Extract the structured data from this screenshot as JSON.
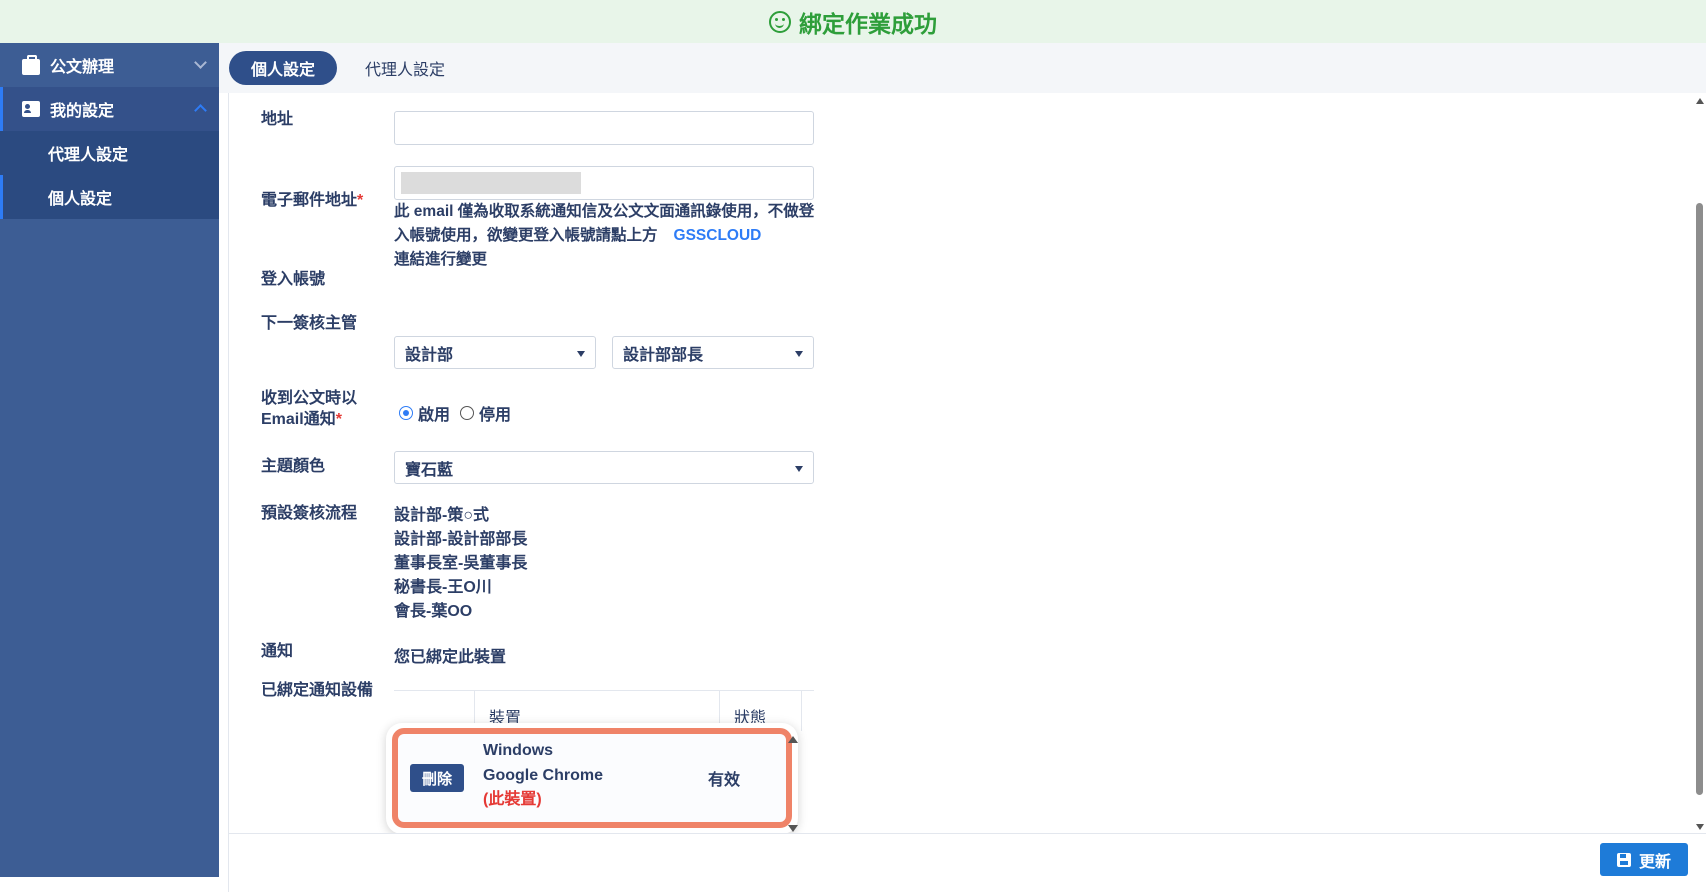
{
  "banner": {
    "message": "綁定作業成功",
    "icon": "smile-icon"
  },
  "sidebar": {
    "items": [
      {
        "label": "公文辦理",
        "icon": "briefcase-icon"
      },
      {
        "label": "我的設定",
        "icon": "id-card-icon"
      }
    ],
    "subitems": [
      {
        "label": "代理人設定"
      },
      {
        "label": "個人設定"
      }
    ]
  },
  "tabs": [
    {
      "label": "個人設定"
    },
    {
      "label": "代理人設定"
    }
  ],
  "form": {
    "address": {
      "label": "地址",
      "value": ""
    },
    "email": {
      "label": "電子郵件地址",
      "required_mark": "*",
      "note": "此 email 僅為收取系統通知信及公文文面通訊錄使用，不做登入帳號使用，欲變更登入帳號請點上方",
      "link": "GSSCLOUD",
      "note_tail": "連結進行變更"
    },
    "login": {
      "label": "登入帳號"
    },
    "supervisor": {
      "label": "下一簽核主管",
      "dept": "設計部",
      "person": "設計部部長"
    },
    "email_notify": {
      "label_line1": "收到公文時以",
      "label_line2": "Email通知",
      "required_mark": "*",
      "option_on": "啟用",
      "option_off": "停用",
      "selected": "啟用"
    },
    "theme": {
      "label": "主題顏色",
      "value": "寶石藍"
    },
    "flow": {
      "label": "預設簽核流程",
      "steps": [
        "設計部-策○式",
        "設計部-設計部部長",
        "董事長室-吳董事長",
        "秘書長-王O川",
        "會長-葉OO"
      ]
    },
    "notice": {
      "label": "通知",
      "value": "您已綁定此裝置"
    },
    "devices": {
      "label": "已綁定通知設備",
      "col_device": "裝置",
      "col_status": "狀態",
      "rows": [
        {
          "delete": "刪除",
          "os": "Windows",
          "browser": "Google Chrome",
          "this_device": "(此裝置)",
          "status": "有效"
        }
      ]
    }
  },
  "footer": {
    "update_label": "更新"
  }
}
